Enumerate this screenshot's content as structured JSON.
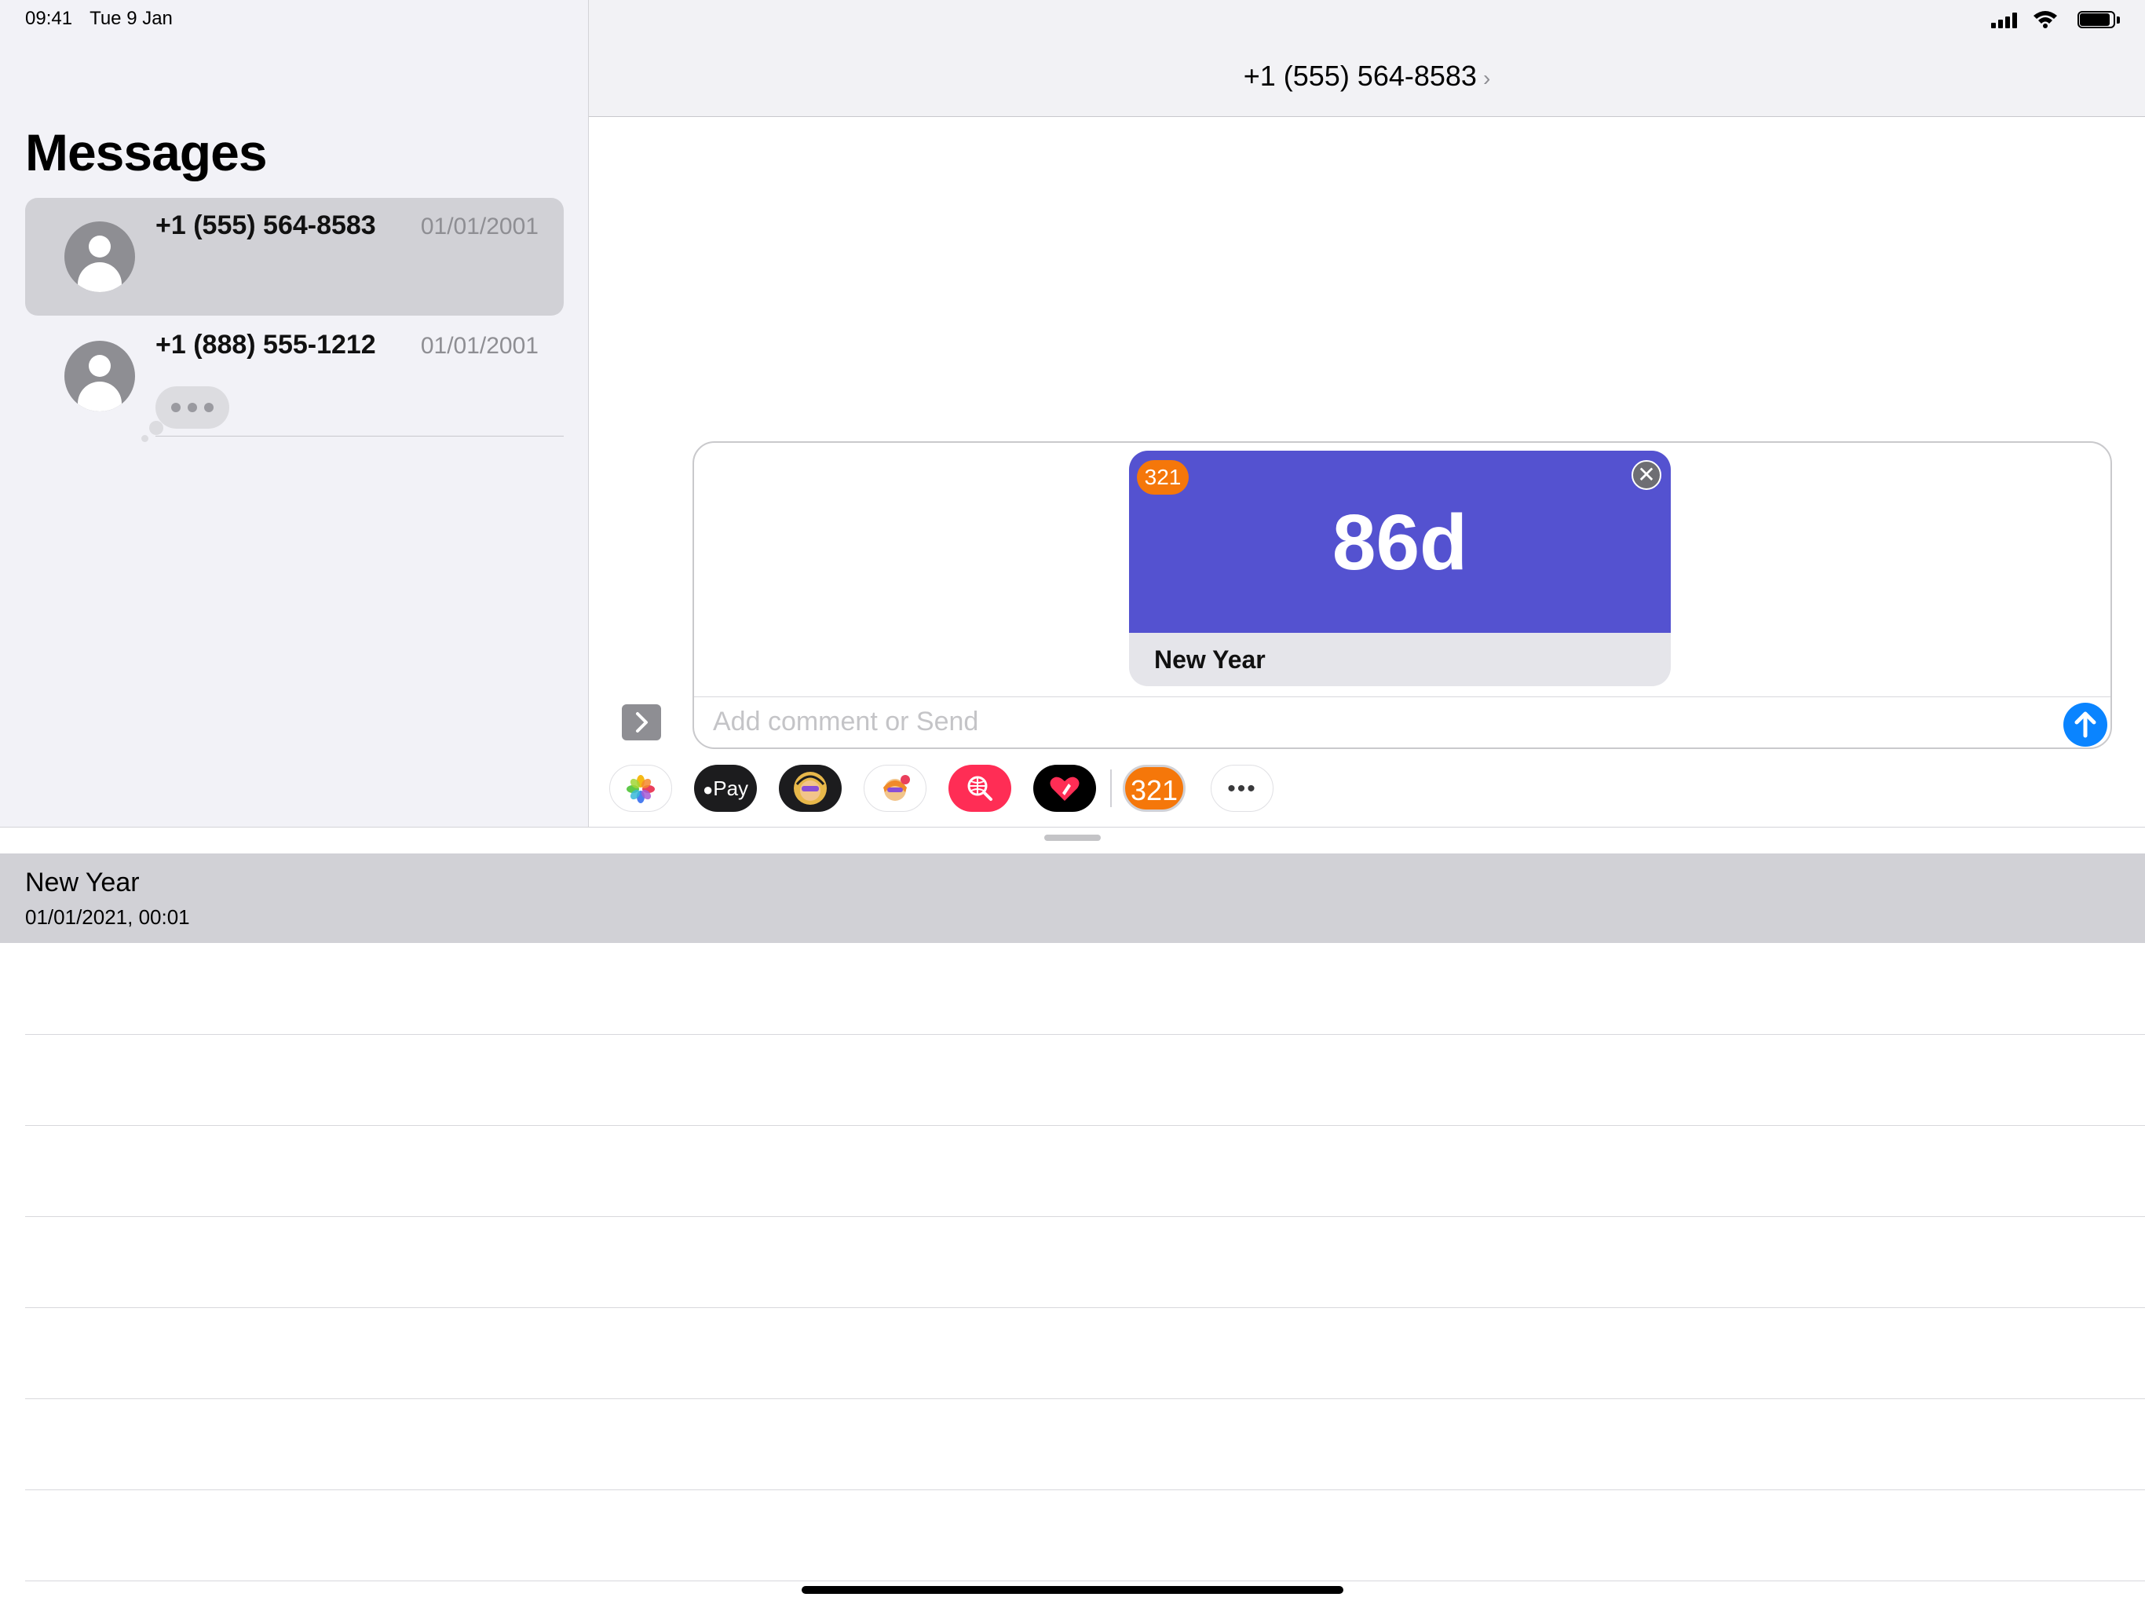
{
  "status_bar": {
    "time": "09:41",
    "date": "Tue 9 Jan"
  },
  "sidebar": {
    "title": "Messages",
    "conversations": [
      {
        "name": "+1 (555) 564-8583",
        "date": "01/01/2001",
        "selected": true
      },
      {
        "name": "+1 (888) 555-1212",
        "date": "01/01/2001",
        "typing": true
      }
    ]
  },
  "conversation": {
    "contact": "+1 (555) 564-8583",
    "chevron": "›"
  },
  "compose": {
    "placeholder": "Add comment or Send",
    "attachment": {
      "badge": "321",
      "value": "86d",
      "caption": "New Year",
      "color": "#5452d0",
      "badge_color": "#f5770a"
    }
  },
  "app_drawer": {
    "apps": [
      {
        "name": "photos-icon"
      },
      {
        "name": "apple-pay-icon",
        "label": "Pay"
      },
      {
        "name": "memoji-stickers-icon"
      },
      {
        "name": "animoji-icon"
      },
      {
        "name": "image-search-icon"
      },
      {
        "name": "digital-touch-icon"
      },
      {
        "name": "countdown-app-icon",
        "label": "321",
        "selected": true
      },
      {
        "name": "more-apps-icon",
        "label": "•••"
      }
    ]
  },
  "events": [
    {
      "title": "New Year",
      "date": "01/01/2021, 00:01"
    }
  ],
  "colors": {
    "accent": "#0a84ff",
    "selected_row": "#d1d1d6",
    "orange": "#f5770a"
  }
}
